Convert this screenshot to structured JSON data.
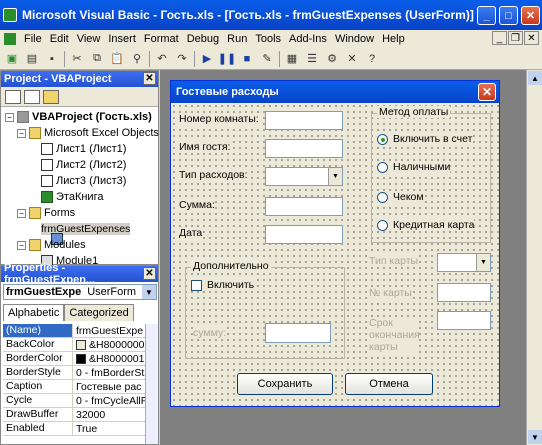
{
  "window": {
    "title": "Microsoft Visual Basic - Гость.xls - [Гость.xls - frmGuestExpenses (UserForm)]"
  },
  "menu": [
    "File",
    "Edit",
    "View",
    "Insert",
    "Format",
    "Debug",
    "Run",
    "Tools",
    "Add-Ins",
    "Window",
    "Help"
  ],
  "project": {
    "title": "Project - VBAProject",
    "tree": [
      {
        "label": "VBAProject (Гость.xls)",
        "icon": "project-icon"
      },
      {
        "label": "Microsoft Excel Objects",
        "icon": "folder-icon"
      },
      {
        "label": "Лист1 (Лист1)",
        "icon": "sheet-icon"
      },
      {
        "label": "Лист2 (Лист2)",
        "icon": "sheet-icon"
      },
      {
        "label": "Лист3 (Лист3)",
        "icon": "sheet-icon"
      },
      {
        "label": "ЭтаКнига",
        "icon": "workbook-icon"
      },
      {
        "label": "Forms",
        "icon": "folder-icon"
      },
      {
        "label": "frmGuestExpenses",
        "icon": "userform-icon"
      },
      {
        "label": "Modules",
        "icon": "folder-icon"
      },
      {
        "label": "Module1",
        "icon": "module-icon"
      }
    ]
  },
  "properties": {
    "title": "Properties - frmGuestExpen...",
    "object_name": "frmGuestExpe",
    "object_type": "UserForm",
    "tabs": [
      "Alphabetic",
      "Categorized"
    ],
    "rows": [
      {
        "k": "(Name)",
        "v": "frmGuestExpe"
      },
      {
        "k": "BackColor",
        "v": "&H8000000"
      },
      {
        "k": "BorderColor",
        "v": "&H8000001"
      },
      {
        "k": "BorderStyle",
        "v": "0 - fmBorderSt"
      },
      {
        "k": "Caption",
        "v": "Гостевые рас"
      },
      {
        "k": "Cycle",
        "v": "0 - fmCycleAllF"
      },
      {
        "k": "DrawBuffer",
        "v": "32000"
      },
      {
        "k": "Enabled",
        "v": "True"
      }
    ],
    "colors": {
      "backcolor": "#ece9d8",
      "bordercolor": "#000000"
    }
  },
  "form": {
    "title": "Гостевые расходы",
    "labels": {
      "room": "Номер комнаты:",
      "guest": "Имя гостя:",
      "expense_type": "Тип расходов:",
      "amount": "Сумма:",
      "date": "Дата"
    },
    "extra": {
      "title": "Дополнительно",
      "include": "Включить",
      "amount": "сумму:"
    },
    "payment": {
      "title": "Метод оплаты",
      "options": [
        "Включить в счет",
        "Наличными",
        "Чеком",
        "Кредитная карта"
      ],
      "card_type": "Тип карты",
      "card_no": "№ карты",
      "card_exp": "Срок окончания карты"
    },
    "buttons": {
      "save": "Сохранить",
      "cancel": "Отмена"
    }
  }
}
